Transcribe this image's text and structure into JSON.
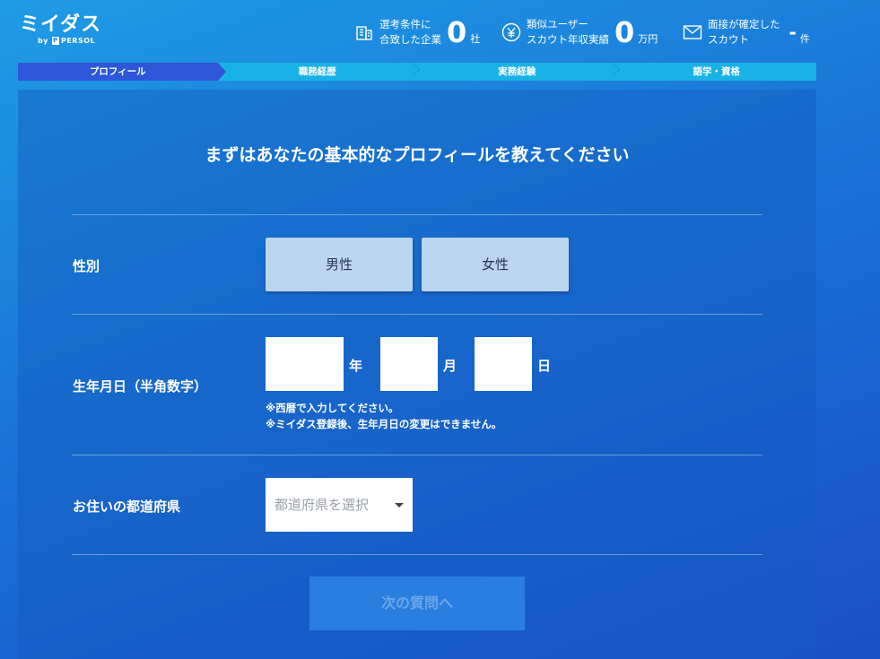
{
  "header": {
    "logo": {
      "main": "ミイダス",
      "sub_by": "by",
      "sub_brand": "PERSOL"
    },
    "stats": [
      {
        "icon": "building-icon",
        "label_line1": "選考条件に",
        "label_line2": "合致した企業",
        "value": "0",
        "unit": "社"
      },
      {
        "icon": "yen-icon",
        "label_line1": "類似ユーザー",
        "label_line2": "スカウト年収実績",
        "value": "0",
        "unit": "万円"
      },
      {
        "icon": "mail-icon",
        "label_line1": "面接が確定した",
        "label_line2": "スカウト",
        "value": "-",
        "unit": "件"
      }
    ]
  },
  "steps": [
    {
      "label": "プロフィール",
      "active": true
    },
    {
      "label": "職務経歴",
      "active": false
    },
    {
      "label": "実務経験",
      "active": false
    },
    {
      "label": "語学・資格",
      "active": false
    }
  ],
  "form": {
    "title": "まずはあなたの基本的なプロフィールを教えてください",
    "gender": {
      "label": "性別",
      "options": [
        "男性",
        "女性"
      ]
    },
    "birthdate": {
      "label": "生年月日（半角数字）",
      "year_unit": "年",
      "month_unit": "月",
      "day_unit": "日",
      "year_value": "",
      "month_value": "",
      "day_value": "",
      "notes": [
        "※西暦で入力してください。",
        "※ミイダス登録後、生年月日の変更はできません。"
      ]
    },
    "prefecture": {
      "label": "お住いの都道府県",
      "placeholder": "都道府県を選択"
    },
    "next_button": "次の質問へ"
  },
  "colors": {
    "step_active": "#2d57d8",
    "step_inactive": "#19b2e6",
    "gender_button": "#bcd5ee",
    "next_button": "#2a7ee0"
  }
}
